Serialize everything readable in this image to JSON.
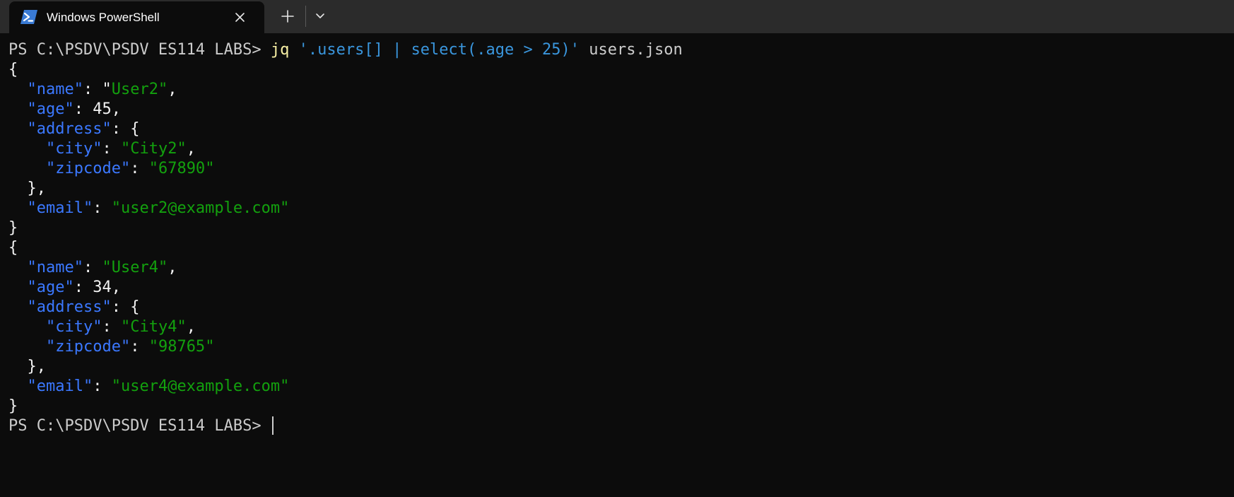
{
  "window": {
    "tab_title": "Windows PowerShell",
    "icons": {
      "tab": "powershell-icon",
      "close": "close-icon",
      "new_tab": "plus-icon",
      "dropdown": "chevron-down-icon"
    }
  },
  "colors": {
    "background": "#0c0c0c",
    "titlebar": "#2b2b2b",
    "text": "#cccccc",
    "key": "#3b78ff",
    "string": "#13a10e",
    "command": "#f9f1a5",
    "argument": "#3a96dd"
  },
  "terminal": {
    "prompt": "PS C:\\PSDV\\PSDV ES114 LABS> ",
    "command": {
      "name": "jq",
      "filter": "'.users[] | select(.age > 25)'",
      "file": "users.json"
    },
    "output": [
      {
        "name": "User2",
        "age": "45",
        "city": "City2",
        "zipcode": "67890",
        "email": "user2@example.com"
      },
      {
        "name": "User4",
        "age": "34",
        "city": "City4",
        "zipcode": "98765",
        "email": "user4@example.com"
      }
    ],
    "json_keys": {
      "name": "\"name\"",
      "age": "\"age\"",
      "address": "\"address\"",
      "city": "\"city\"",
      "zipcode": "\"zipcode\"",
      "email": "\"email\""
    }
  }
}
